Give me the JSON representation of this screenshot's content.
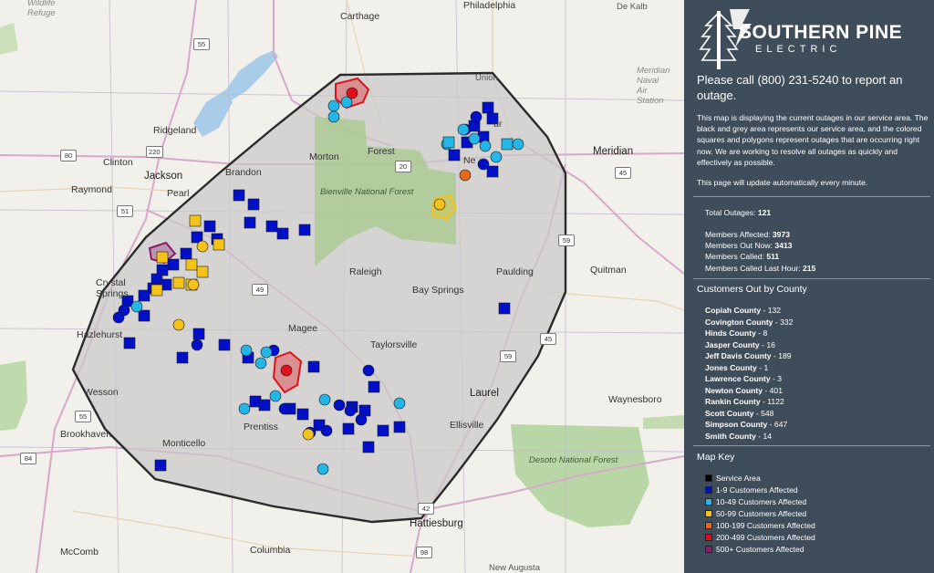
{
  "map": {
    "place_labels": [
      {
        "id": "wildlife-refuge",
        "text": "Wildlife\nRefuge"
      },
      {
        "id": "carthage",
        "text": "Carthage"
      },
      {
        "id": "philadelphia",
        "text": "Philadelphia"
      },
      {
        "id": "de-kalb",
        "text": "De Kalb"
      },
      {
        "id": "meridian-nas",
        "text": "Meridian\nNaval\nAir\nStation"
      },
      {
        "id": "union",
        "text": "Union"
      },
      {
        "id": "ridgeland",
        "text": "Ridgeland"
      },
      {
        "id": "clinton",
        "text": "Clinton"
      },
      {
        "id": "jackson",
        "text": "Jackson"
      },
      {
        "id": "pearl",
        "text": "Pearl"
      },
      {
        "id": "brandon",
        "text": "Brandon"
      },
      {
        "id": "raymond",
        "text": "Raymond"
      },
      {
        "id": "morton",
        "text": "Morton"
      },
      {
        "id": "forest",
        "text": "Forest"
      },
      {
        "id": "meridian",
        "text": "Meridian"
      },
      {
        "id": "bienville",
        "text": "Bienville National Forest"
      },
      {
        "id": "raleigh",
        "text": "Raleigh"
      },
      {
        "id": "bay-springs",
        "text": "Bay Springs"
      },
      {
        "id": "paulding",
        "text": "Paulding"
      },
      {
        "id": "quitman",
        "text": "Quitman"
      },
      {
        "id": "crystal-springs",
        "text": "Crystal\nSprings"
      },
      {
        "id": "hazlehurst",
        "text": "Hazlehurst"
      },
      {
        "id": "magee",
        "text": "Magee"
      },
      {
        "id": "taylorsville",
        "text": "Taylorsville"
      },
      {
        "id": "wesson",
        "text": "Wesson"
      },
      {
        "id": "laurel",
        "text": "Laurel"
      },
      {
        "id": "waynesboro",
        "text": "Waynesboro"
      },
      {
        "id": "prentiss",
        "text": "Prentiss"
      },
      {
        "id": "ellisville",
        "text": "Ellisville"
      },
      {
        "id": "brookhaven",
        "text": "Brookhaven"
      },
      {
        "id": "monticello",
        "text": "Monticello"
      },
      {
        "id": "desoto",
        "text": "Desoto National Forest"
      },
      {
        "id": "hattiesburg",
        "text": "Hattiesburg"
      },
      {
        "id": "mccomb",
        "text": "McComb"
      },
      {
        "id": "columbia",
        "text": "Columbia"
      },
      {
        "id": "new-augusta",
        "text": "New Augusta"
      },
      {
        "id": "nes",
        "text": "Ne"
      },
      {
        "id": "ur",
        "text": "ur"
      }
    ],
    "highway_shields": [
      "55",
      "220",
      "80",
      "51",
      "20",
      "49",
      "45",
      "59",
      "59",
      "55",
      "84",
      "42",
      "98",
      "45"
    ],
    "colors": {
      "service_area_fill": "#cbcbcb",
      "service_area_stroke": "#2a2a2a",
      "c1_9": "#0010c8",
      "c10_49": "#23b6e6",
      "c50_99": "#f3c31a",
      "c100_199": "#e8681a",
      "c200_499": "#e0101a",
      "c500_plus": "#8a1a6a"
    }
  },
  "panel": {
    "logo_line1": "SOUTHERN PINE",
    "logo_line2": "ELECTRIC",
    "call_text": "Please call (800) 231-5240 to report an outage.",
    "description": "This map is displaying the current outages in our service area. The black and grey area represents our service area, and the colored squares and polygons represent outages that are occurring right now. We are working to resolve all outages as quickly and effectively as possible.",
    "update_note": "This page will update automatically every minute.",
    "total_outages_label": "Total Outages:",
    "total_outages_value": "121",
    "members_affected_label": "Members Affected:",
    "members_affected_value": "3973",
    "members_out_now_label": "Members Out Now:",
    "members_out_now_value": "3413",
    "members_called_label": "Members Called:",
    "members_called_value": "511",
    "members_called_last_hour_label": "Members Called Last Hour:",
    "members_called_last_hour_value": "215",
    "county_heading": "Customers Out by County",
    "counties": [
      {
        "name": "Copiah County",
        "value": "- 132"
      },
      {
        "name": "Covington County",
        "value": "- 332"
      },
      {
        "name": "Hinds County",
        "value": "- 8"
      },
      {
        "name": "Jasper County",
        "value": "- 16"
      },
      {
        "name": "Jeff Davis County",
        "value": "- 189"
      },
      {
        "name": "Jones County",
        "value": "- 1"
      },
      {
        "name": "Lawrence County",
        "value": "- 3"
      },
      {
        "name": "Newton County",
        "value": "- 401"
      },
      {
        "name": "Rankin County",
        "value": "- 1122"
      },
      {
        "name": "Scott County",
        "value": "- 548"
      },
      {
        "name": "Simpson County",
        "value": "- 647"
      },
      {
        "name": "Smith County",
        "value": "- 14"
      }
    ],
    "key_heading": "Map Key",
    "key": [
      {
        "label": "Service Area",
        "color": "#000000"
      },
      {
        "label": "1-9 Customers Affected",
        "color": "#0010c8"
      },
      {
        "label": "10-49 Customers Affected",
        "color": "#23b6e6"
      },
      {
        "label": "50-99 Customers Affected",
        "color": "#f3c31a"
      },
      {
        "label": "100-199 Customers Affected",
        "color": "#e8681a"
      },
      {
        "label": "200-499 Customers Affected",
        "color": "#e0101a"
      },
      {
        "label": "500+ Customers Affected",
        "color": "#8a1a6a"
      }
    ]
  }
}
